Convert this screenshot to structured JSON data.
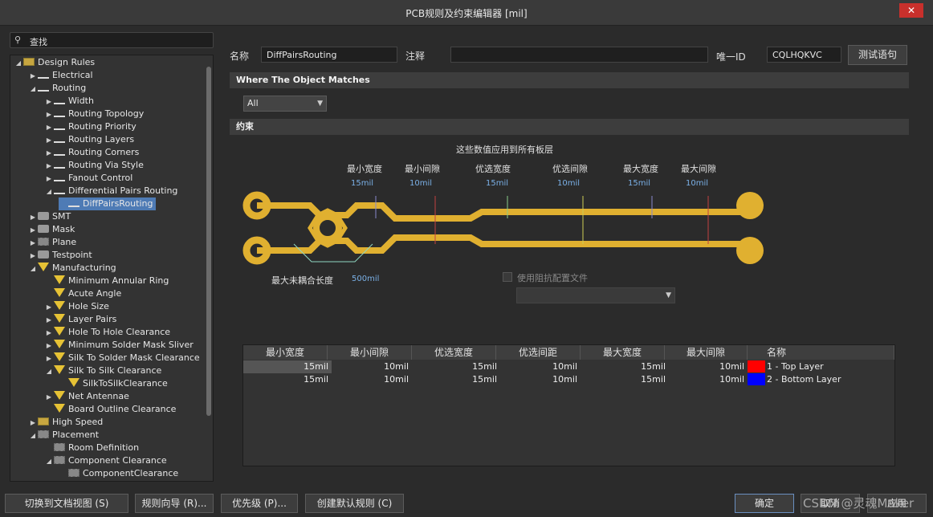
{
  "window": {
    "title": "PCB规则及约束编辑器 [mil]",
    "close_icon": "close-icon"
  },
  "search": {
    "placeholder": "查找"
  },
  "tree": {
    "items": [
      {
        "label": "Design Rules",
        "arrow": "◢",
        "icon": "folder",
        "level": 0
      },
      {
        "label": "Electrical",
        "arrow": "▶",
        "icon": "rule",
        "level": 1
      },
      {
        "label": "Routing",
        "arrow": "◢",
        "icon": "rule",
        "level": 1
      },
      {
        "label": "Width",
        "arrow": "▶",
        "icon": "rule",
        "level": 2
      },
      {
        "label": "Routing Topology",
        "arrow": "▶",
        "icon": "rule",
        "level": 2
      },
      {
        "label": "Routing Priority",
        "arrow": "▶",
        "icon": "rule",
        "level": 2
      },
      {
        "label": "Routing Layers",
        "arrow": "▶",
        "icon": "rule",
        "level": 2
      },
      {
        "label": "Routing Corners",
        "arrow": "▶",
        "icon": "rule",
        "level": 2
      },
      {
        "label": "Routing Via Style",
        "arrow": "▶",
        "icon": "rule",
        "level": 2
      },
      {
        "label": "Fanout Control",
        "arrow": "▶",
        "icon": "rule",
        "level": 2
      },
      {
        "label": "Differential Pairs Routing",
        "arrow": "◢",
        "icon": "rule",
        "level": 2
      },
      {
        "label": "DiffPairsRouting",
        "arrow": "",
        "icon": "rule",
        "level": 3,
        "selected": true
      },
      {
        "label": "SMT",
        "arrow": "▶",
        "icon": "grey",
        "level": 1
      },
      {
        "label": "Mask",
        "arrow": "▶",
        "icon": "grey",
        "level": 1
      },
      {
        "label": "Plane",
        "arrow": "▶",
        "icon": "chip",
        "level": 1
      },
      {
        "label": "Testpoint",
        "arrow": "▶",
        "icon": "grey",
        "level": 1
      },
      {
        "label": "Manufacturing",
        "arrow": "◢",
        "icon": "yel",
        "level": 1
      },
      {
        "label": "Minimum Annular Ring",
        "arrow": "",
        "icon": "yel",
        "level": 2
      },
      {
        "label": "Acute Angle",
        "arrow": "",
        "icon": "yel",
        "level": 2
      },
      {
        "label": "Hole Size",
        "arrow": "▶",
        "icon": "yel",
        "level": 2
      },
      {
        "label": "Layer Pairs",
        "arrow": "▶",
        "icon": "yel",
        "level": 2
      },
      {
        "label": "Hole To Hole Clearance",
        "arrow": "▶",
        "icon": "yel",
        "level": 2
      },
      {
        "label": "Minimum Solder Mask Sliver",
        "arrow": "▶",
        "icon": "yel",
        "level": 2
      },
      {
        "label": "Silk To Solder Mask Clearance",
        "arrow": "▶",
        "icon": "yel",
        "level": 2
      },
      {
        "label": "Silk To Silk Clearance",
        "arrow": "◢",
        "icon": "yel",
        "level": 2
      },
      {
        "label": "SilkToSilkClearance",
        "arrow": "",
        "icon": "yel",
        "level": 3
      },
      {
        "label": "Net Antennae",
        "arrow": "▶",
        "icon": "yel",
        "level": 2
      },
      {
        "label": "Board Outline Clearance",
        "arrow": "",
        "icon": "yel",
        "level": 2
      },
      {
        "label": "High Speed",
        "arrow": "▶",
        "icon": "folder",
        "level": 1
      },
      {
        "label": "Placement",
        "arrow": "◢",
        "icon": "chip",
        "level": 1
      },
      {
        "label": "Room Definition",
        "arrow": "",
        "icon": "chip",
        "level": 2
      },
      {
        "label": "Component Clearance",
        "arrow": "◢",
        "icon": "chip",
        "level": 2
      },
      {
        "label": "ComponentClearance",
        "arrow": "",
        "icon": "chip",
        "level": 3
      }
    ]
  },
  "form": {
    "name_label": "名称",
    "name_value": "DiffPairsRouting",
    "comment_label": "注释",
    "comment_value": "",
    "uid_label": "唯一ID",
    "uid_value": "CQLHQKVC",
    "test_button": "测试语句"
  },
  "where": {
    "header": "Where The Object Matches",
    "combo_value": "All"
  },
  "constraints": {
    "header": "约束",
    "note": "这些数值应用到所有板层",
    "caps": [
      "最小宽度",
      "最小间隙",
      "优选宽度",
      "优选间隙",
      "最大宽度",
      "最大间隙"
    ],
    "vals": [
      "15mil",
      "10mil",
      "15mil",
      "10mil",
      "15mil",
      "10mil"
    ],
    "uncoupled_label": "最大未耦合长度",
    "uncoupled_value": "500mil",
    "impedance_label": "使用阻抗配置文件",
    "trace_color": "#e0b030"
  },
  "grid": {
    "headers": [
      "最小宽度",
      "最小间隙",
      "优选宽度",
      "优选间距",
      "最大宽度",
      "最大间隙",
      "名称"
    ],
    "rows": [
      {
        "cells": [
          "15mil",
          "10mil",
          "15mil",
          "10mil",
          "15mil",
          "10mil"
        ],
        "layer": "1 - Top Layer",
        "color": "#ff0000"
      },
      {
        "cells": [
          "15mil",
          "10mil",
          "15mil",
          "10mil",
          "15mil",
          "10mil"
        ],
        "layer": "2 - Bottom Layer",
        "color": "#0000ff"
      }
    ]
  },
  "footer": {
    "doc_view": "切换到文档视图 (S)",
    "wizard": "规则向导 (R)...",
    "priority": "优先级 (P)...",
    "default": "创建默认规则 (C)",
    "ok": "确定",
    "cancel": "取消",
    "apply": "应用"
  },
  "watermark": "CSDN @灵魂Maker"
}
